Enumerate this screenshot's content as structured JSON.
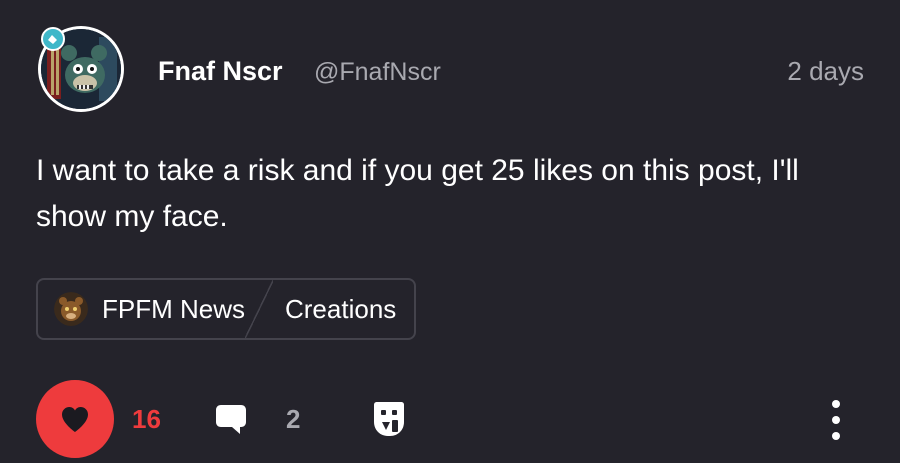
{
  "post": {
    "author": {
      "name": "Fnaf Nscr",
      "handle": "@FnafNscr",
      "avatar_icon": "animatronic-bear-avatar-icon"
    },
    "timestamp": "2 days",
    "body": "I want to take a risk and if you get 25 likes on this post, I'll show my face.",
    "tags": {
      "community": "FPFM News",
      "community_icon": "community-avatar-icon",
      "category": "Creations"
    },
    "actions": {
      "like_count": "16",
      "comment_count": "2",
      "like_icon": "heart-icon",
      "comment_icon": "speech-bubble-icon",
      "share_icon": "share-icon",
      "more_icon": "more-vertical-icon"
    }
  },
  "colors": {
    "background": "#24232b",
    "like_accent": "#ee3b3d",
    "muted_text": "#a9a9b0",
    "border": "#44434c"
  }
}
